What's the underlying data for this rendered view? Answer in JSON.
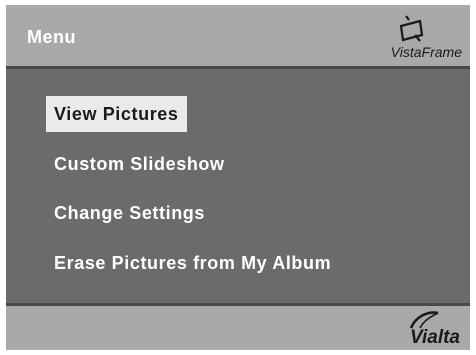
{
  "header": {
    "title": "Menu",
    "brand": "VistaFrame",
    "brand_icon": "vistaframe-logo-icon"
  },
  "menu": {
    "items": [
      {
        "label": "View Pictures",
        "selected": true
      },
      {
        "label": "Custom Slideshow",
        "selected": false
      },
      {
        "label": "Change Settings",
        "selected": false
      },
      {
        "label": "Erase Pictures from My Album",
        "selected": false
      }
    ]
  },
  "footer": {
    "brand": "Vialta",
    "brand_icon": "vialta-logo-icon"
  },
  "colors": {
    "header_bg": "#a9a9a9",
    "body_bg": "#6b6b6b",
    "divider": "#4a4a4a",
    "selection_bg": "#eaeaea",
    "text": "#ffffff"
  }
}
